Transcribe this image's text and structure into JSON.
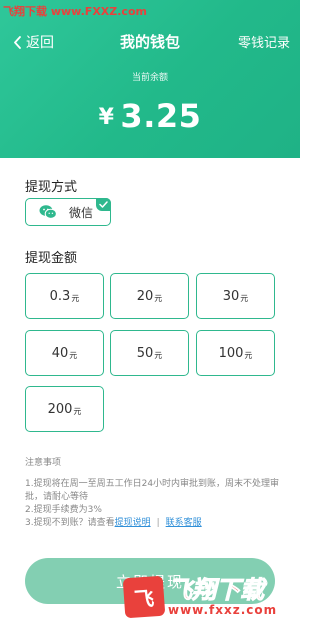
{
  "watermark": {
    "site": "飞翔下载",
    "url": "www.FXXZ.com"
  },
  "nav": {
    "back_label": "返回",
    "title": "我的钱包",
    "records_label": "零钱记录"
  },
  "wallet": {
    "balance_label": "当前余额",
    "currency": "¥",
    "balance": "3.25"
  },
  "withdraw_method": {
    "section_title": "提现方式",
    "selected_label": "微信"
  },
  "amounts": {
    "section_title": "提现金额",
    "options": [
      {
        "value": "0.3",
        "unit": "元"
      },
      {
        "value": "20",
        "unit": "元"
      },
      {
        "value": "30",
        "unit": "元"
      },
      {
        "value": "40",
        "unit": "元"
      },
      {
        "value": "50",
        "unit": "元"
      },
      {
        "value": "100",
        "unit": "元"
      },
      {
        "value": "200",
        "unit": "元"
      }
    ]
  },
  "notes": {
    "title": "注意事项",
    "line1": "1.提现将在周一至周五工作日24小时内审批到账，周末不处理审批，请耐心等待",
    "line2": "2.提现手续费为3%",
    "line3_prefix": "3.提现不到账？请查看",
    "link_explain": "提现说明",
    "separator": "|",
    "link_support": "联系客服"
  },
  "submit_label": "立即提现",
  "logo_watermark": {
    "mark": "飞",
    "text_big": "飞翔下载",
    "text_small": "www.fxxz.com"
  },
  "colors": {
    "accent": "#2fb88e",
    "header_start": "#2fc79a",
    "button": "#83cfb2",
    "link": "#2f8fd8"
  }
}
